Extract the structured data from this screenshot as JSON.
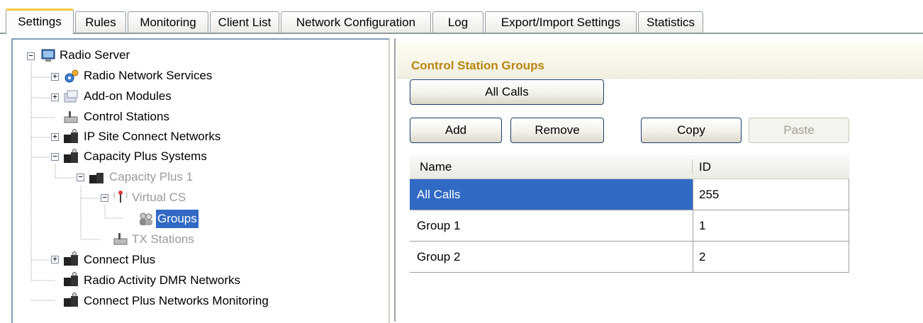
{
  "tabs": [
    {
      "label": "Settings",
      "active": true
    },
    {
      "label": "Rules"
    },
    {
      "label": "Monitoring"
    },
    {
      "label": "Client List"
    },
    {
      "label": "Network Configuration"
    },
    {
      "label": "Log"
    },
    {
      "label": "Export/Import Settings"
    },
    {
      "label": "Statistics"
    }
  ],
  "tree": {
    "items": [
      {
        "label": "Radio Server",
        "icon": "computer-icon",
        "expander": "minus"
      },
      {
        "label": "Radio Network Services",
        "icon": "gear-network-icon",
        "expander": "plus"
      },
      {
        "label": "Add-on Modules",
        "icon": "modules-icon",
        "expander": "plus"
      },
      {
        "label": "Control Stations",
        "icon": "radio-station-icon"
      },
      {
        "label": "IP Site Connect Networks",
        "icon": "repeater-icon",
        "expander": "plus"
      },
      {
        "label": "Capacity Plus Systems",
        "icon": "repeater-icon",
        "expander": "minus"
      },
      {
        "label": "Capacity Plus 1",
        "icon": "repeater-icon",
        "expander": "minus",
        "disabled": true
      },
      {
        "label": "Virtual CS",
        "icon": "antenna-icon",
        "expander": "minus",
        "disabled": true
      },
      {
        "label": "Groups",
        "icon": "group-icon",
        "selected": true
      },
      {
        "label": "TX Stations",
        "icon": "radio-station-icon",
        "disabled": true
      },
      {
        "label": "Connect Plus",
        "icon": "repeater-icon",
        "expander": "plus"
      },
      {
        "label": "Radio Activity DMR Networks",
        "icon": "repeater-icon"
      },
      {
        "label": "Connect Plus Networks Monitoring",
        "icon": "repeater-icon"
      }
    ]
  },
  "panel": {
    "title": "Control Station Groups",
    "buttons": {
      "all_calls": "All Calls",
      "add": "Add",
      "remove": "Remove",
      "copy": "Copy",
      "paste": "Paste"
    },
    "grid": {
      "columns": [
        "Name",
        "ID"
      ],
      "rows": [
        {
          "name": "All Calls",
          "id": "255",
          "selected": true
        },
        {
          "name": "Group 1",
          "id": "1"
        },
        {
          "name": "Group 2",
          "id": "2"
        }
      ]
    }
  },
  "colors": {
    "selection": "#316ac5",
    "title": "#b8860b",
    "tab_highlight": "#ffc83c"
  }
}
